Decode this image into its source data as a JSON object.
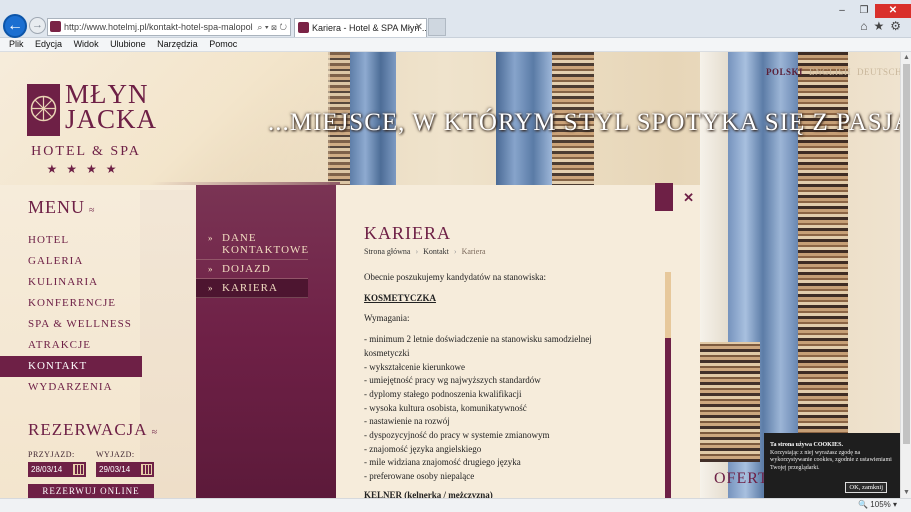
{
  "browser": {
    "address": "http://www.hotelmj.pl/kontakt-hotel-spa-malopol",
    "address_tools": "⌕ ▾ ⊠ ↻",
    "tab_title": "Kariera - Hotel & SPA Młyn ...",
    "window_controls": {
      "minimize": "–",
      "restore": "❐",
      "close": "✕"
    },
    "toolbar_icons": "⌂★⚙",
    "menu": [
      "Plik",
      "Edycja",
      "Widok",
      "Ulubione",
      "Narzędzia",
      "Pomoc"
    ],
    "zoom": "🔍 105%  ▾"
  },
  "site": {
    "logo": {
      "name_line1": "MŁYN",
      "name_line2": "JACKA",
      "sub": "HOTEL & SPA",
      "stars": "★★★★"
    },
    "tagline": "...MIEJSCE, W KTÓRYM STYL SPOTYKA SIĘ Z PASJĄ.",
    "languages": [
      "POLSKI",
      "ENGLISH",
      "DEUTSCH"
    ],
    "menu_title": "MENU",
    "menu_items": [
      "HOTEL",
      "GALERIA",
      "KULINARIA",
      "KONFERENCJE",
      "SPA & WELLNESS",
      "ATRAKCJE",
      "KONTAKT",
      "WYDARZENIA"
    ],
    "submenu": [
      "DANE KONTAKTOWE",
      "DOJAZD",
      "KARIERA"
    ],
    "reservation": {
      "title": "REZERWACJA",
      "arrival_label": "PRZYJAZD:",
      "departure_label": "WYJAZD:",
      "arrival_value": "28/03/14",
      "departure_value": "29/03/14",
      "button": "REZERWUJ ONLINE"
    },
    "oferta": "OFERT"
  },
  "content": {
    "title": "KARIERA",
    "breadcrumb": [
      "Strona główna",
      "Kontakt",
      "Kariera"
    ],
    "intro": "Obecnie poszukujemy kandydatów na stanowiska:",
    "job1": "KOSMETYCZKA",
    "requirements_label": "Wymagania:",
    "requirements": [
      "- minimum 2 letnie doświadczenie na stanowisku  samodzielnej kosmetyczki",
      "- wykształcenie kierunkowe",
      "- umiejętność pracy wg najwyższych standardów",
      "- dyplomy stałego podnoszenia kwalifikacji",
      "- wysoka kultura osobista, komunikatywność",
      "- nastawienie na rozwój",
      "- dyspozycyjność do pracy w systemie zmianowym",
      "- znajomość języka angielskiego",
      "- mile widziana znajomość drugiego języka",
      "- preferowane osoby niepalące"
    ],
    "job2": "KELNER (kelnerka / mężczyzna)"
  },
  "cookie": {
    "title": "Ta strona używa COOKIES.",
    "text": "Korzystając z niej wyrażasz zgodę na wykorzystywanie cookies, zgodnie z ustawieniami Twojej przeglądarki.",
    "button": "OK, zamknij"
  }
}
